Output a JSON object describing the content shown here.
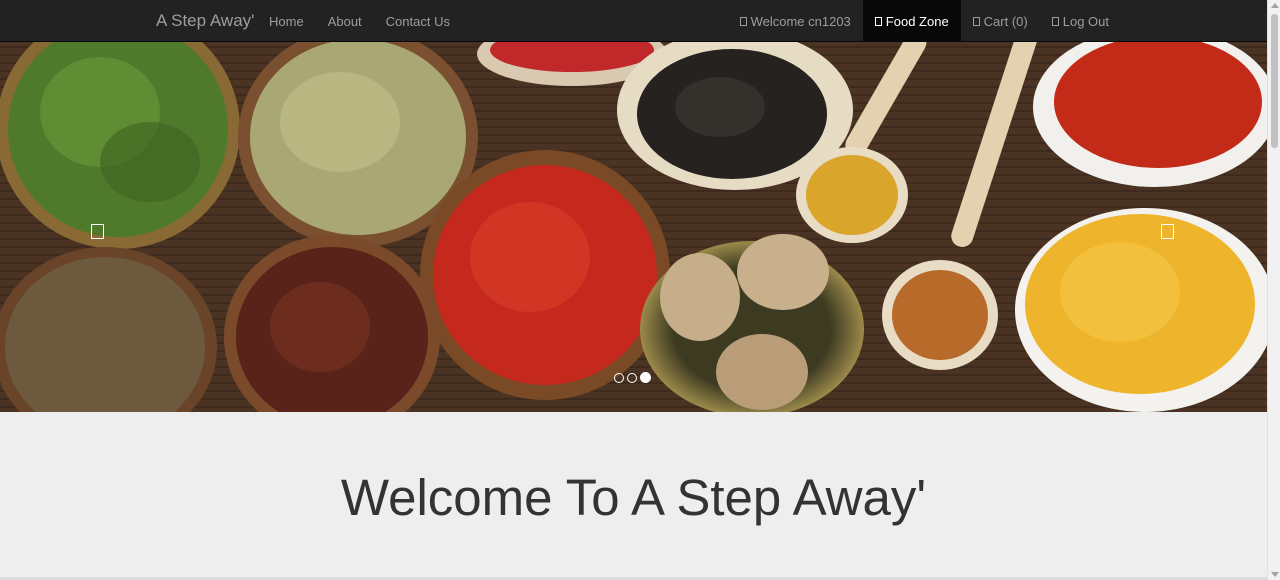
{
  "navbar": {
    "brand": "A Step Away'",
    "left_items": [
      {
        "label": "Home"
      },
      {
        "label": "About"
      },
      {
        "label": "Contact Us"
      }
    ],
    "right_items": [
      {
        "label": "Welcome cn1203",
        "icon": "user-icon"
      },
      {
        "label": "Food Zone",
        "icon": "cutlery-icon",
        "active": true
      },
      {
        "label": "Cart (0)",
        "icon": "cart-icon"
      },
      {
        "label": "Log Out",
        "icon": "logout-icon"
      }
    ]
  },
  "carousel": {
    "slide_count": 3,
    "active_index": 2,
    "image_subject": "spices"
  },
  "main": {
    "heading": "Welcome To A Step Away'"
  }
}
